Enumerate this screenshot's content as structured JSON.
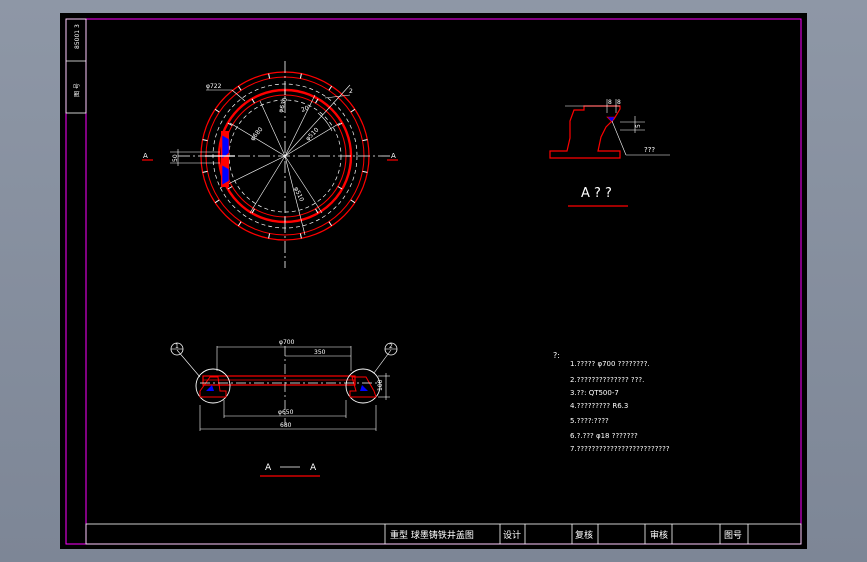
{
  "side_strip": {
    "code": "85001 3",
    "label": "图 号"
  },
  "plan_view": {
    "dia_outer": "φ722",
    "dia_inner": "φ630",
    "dia_frame": "φ680",
    "dia_center": "φ510",
    "angle": "20",
    "top_mark": "2",
    "left_dim": "50",
    "section_left": "A",
    "section_right": "A"
  },
  "detail_view": {
    "dim_a": "8",
    "dim_b": "8",
    "dim_c": "5",
    "leader": "???",
    "title": "A ? ?"
  },
  "section_view": {
    "dim_top": "φ700",
    "dim_half": "350",
    "dim_bottom": "φ650",
    "dim_overall": "680",
    "dim_height": "100",
    "mark_left": "1",
    "mark_right": "2",
    "title_left": "A",
    "title_right": "A"
  },
  "notes": {
    "heading": "?:",
    "items": [
      "1.?????   φ700   ????????.",
      "2.??????????????    ???.",
      "3.??: QT500-7",
      "4.?????????    R6.3",
      "5.????:????",
      "6.?.???    φ18    ???????",
      "7.?????????????????????????"
    ]
  },
  "title_block": {
    "drawing_name": "重型 球墨铸铁井盖图",
    "design": "设计",
    "review": "复核",
    "audit": "审核",
    "drawing_no": "图号"
  },
  "colors": {
    "red": "#ff0000",
    "white": "#ffffff",
    "magenta": "#ff00ff",
    "blue": "#0000ff"
  }
}
